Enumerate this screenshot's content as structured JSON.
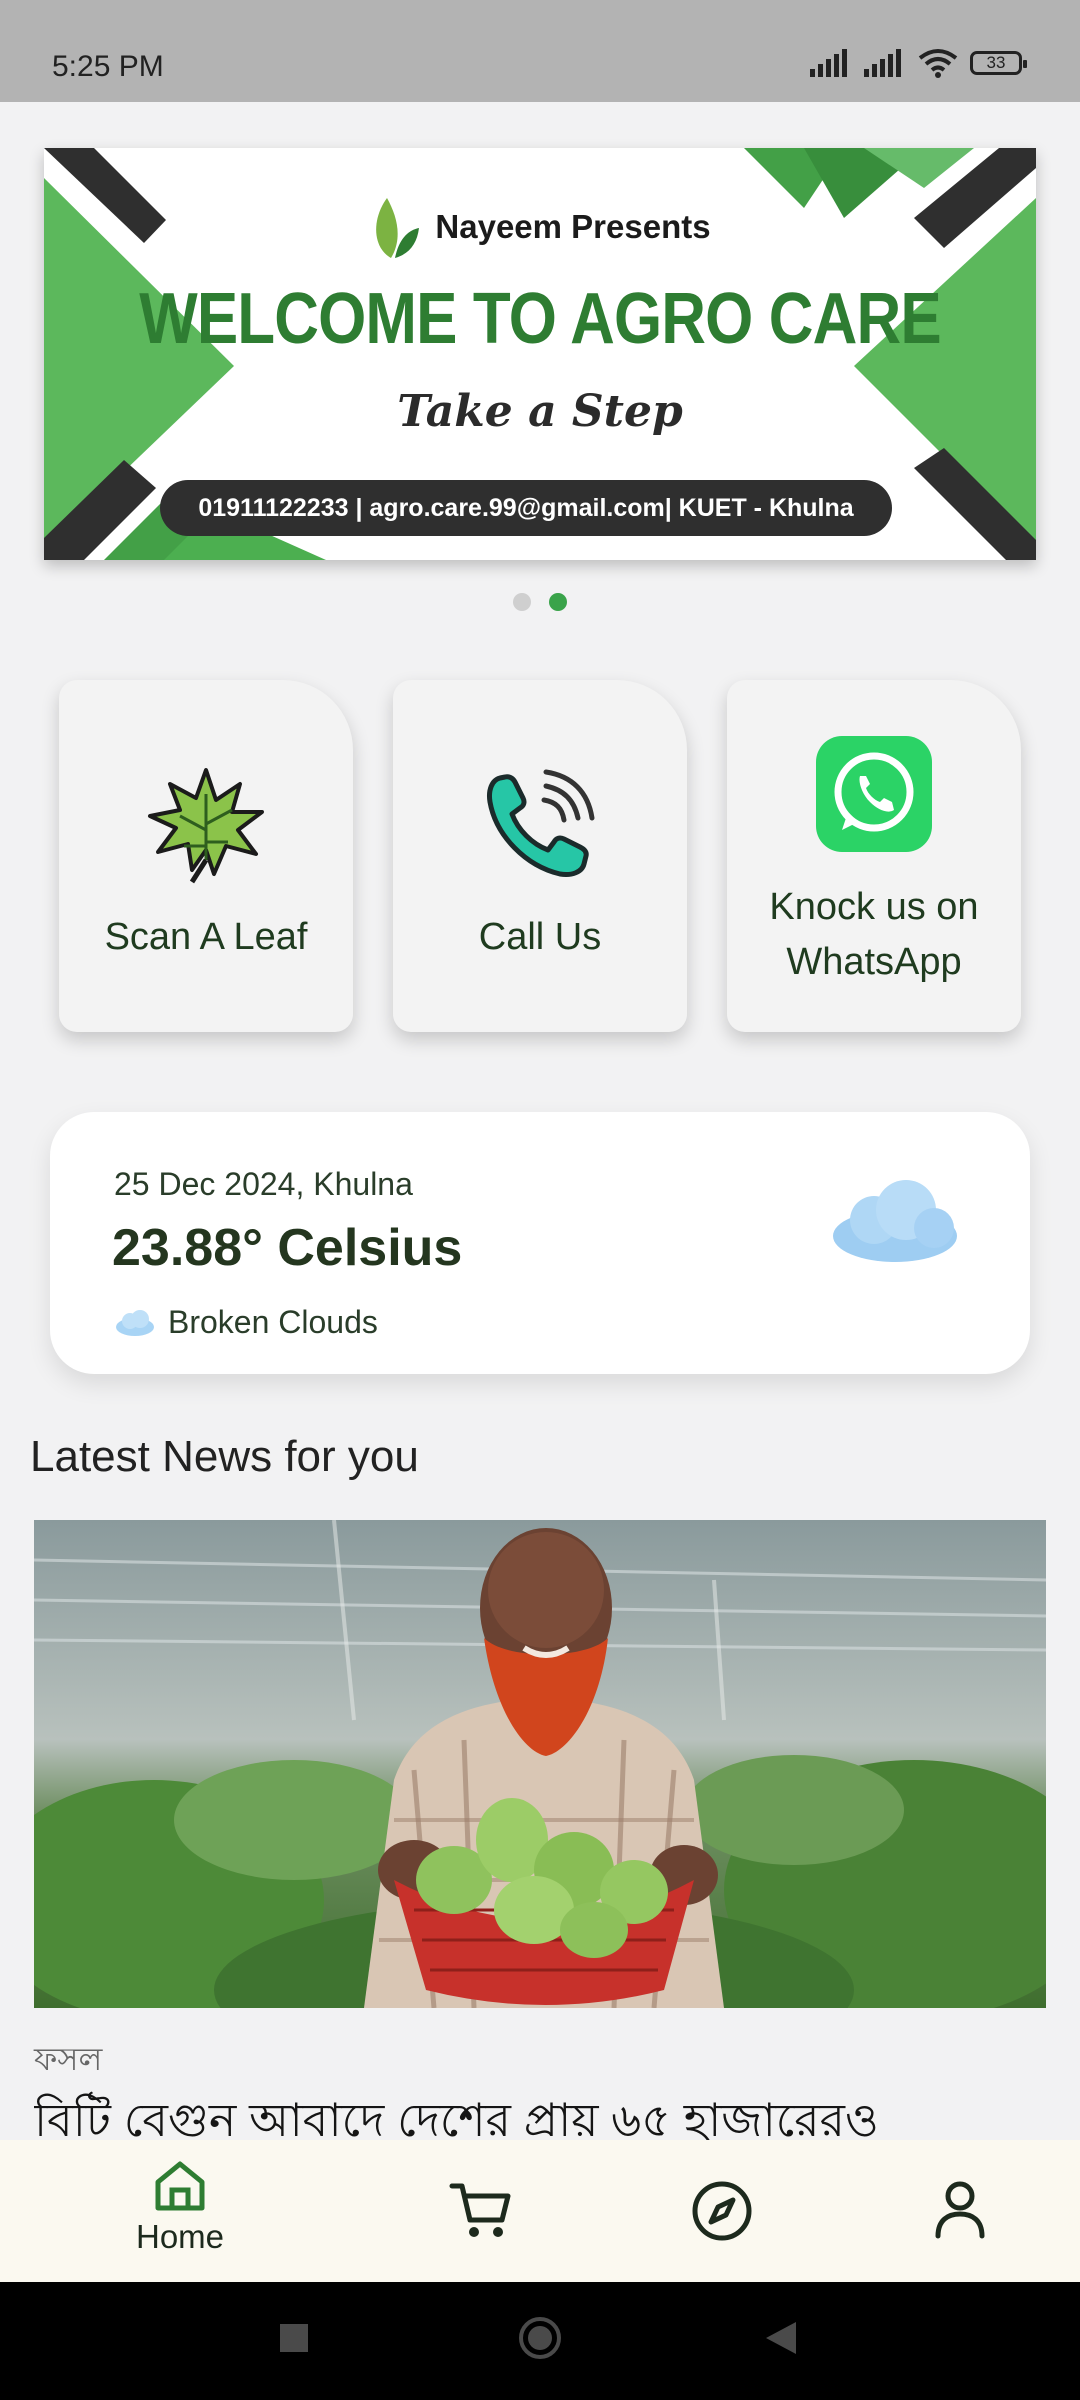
{
  "status_bar": {
    "time": "5:25 PM",
    "battery": "33"
  },
  "banner": {
    "presents": "Nayeem Presents",
    "title": "WELCOME TO AGRO CARE",
    "tagline": "Take a Step",
    "contact": "01911122233 | agro.care.99@gmail.com| KUET - Khulna",
    "pages": 2,
    "active_page": 2
  },
  "actions": [
    {
      "label": "Scan A Leaf",
      "icon": "leaf-icon"
    },
    {
      "label": "Call Us",
      "icon": "phone-icon"
    },
    {
      "label_line1": "Knock us on",
      "label_line2": "WhatsApp",
      "icon": "whatsapp-icon"
    }
  ],
  "weather": {
    "date_location": "25 Dec 2024, Khulna",
    "temperature": "23.88° Celsius",
    "description": "Broken Clouds"
  },
  "news": {
    "heading": "Latest News for you",
    "category": "ফসল",
    "title": "বিটি বেগুন আবাদে দেশের প্রায় ৬৫ হাজারেরও"
  },
  "bottom_nav": {
    "home_label": "Home"
  },
  "colors": {
    "brand_green": "#2e7d32",
    "accent_green": "#4caf50",
    "whatsapp_green": "#25d366",
    "banner_dark": "#2f2f2f"
  }
}
